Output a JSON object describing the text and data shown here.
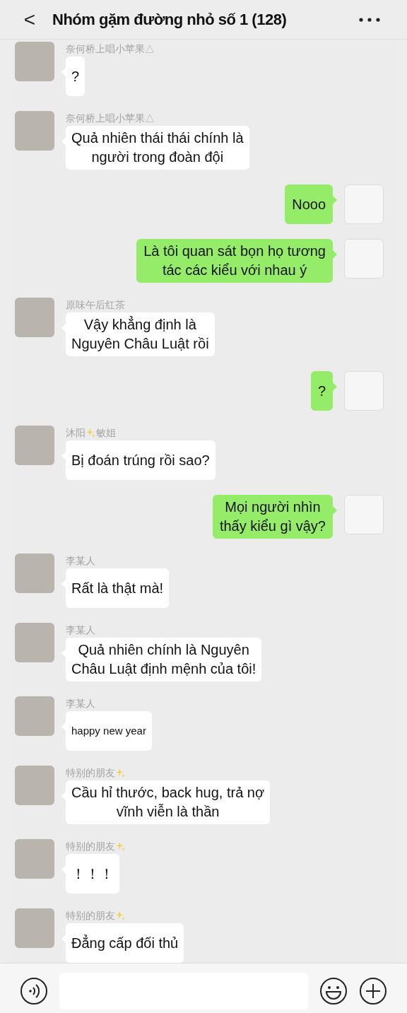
{
  "header": {
    "back": "<",
    "title": "Nhóm gặm đường nhỏ số 1 (128)"
  },
  "messages": [
    {
      "kind": "incoming",
      "name": [
        "奈何桥上唱小苹果△"
      ],
      "sparkle_end": false,
      "text": "?"
    },
    {
      "kind": "incoming",
      "name": [
        "奈何桥上唱小苹果△"
      ],
      "sparkle_end": false,
      "text": "Quả nhiên thái thái chính là\nngười trong đoàn đội"
    },
    {
      "kind": "outgoing",
      "text": "Nooo"
    },
    {
      "kind": "outgoing",
      "text": "Là tôi quan sát bọn họ tương\ntác các kiểu với nhau ý"
    },
    {
      "kind": "incoming",
      "name": [
        "原味午后红茶"
      ],
      "sparkle_end": false,
      "text": "Vậy khẳng định là\nNguyên Châu Luật rồi"
    },
    {
      "kind": "outgoing",
      "text": "?"
    },
    {
      "kind": "incoming",
      "name": [
        "沐阳",
        "敏姐"
      ],
      "sparkle_end": false,
      "text": "Bị đoán trúng rồi sao?"
    },
    {
      "kind": "outgoing",
      "text": "Mọi người nhìn\nthấy kiểu gì vậy?"
    },
    {
      "kind": "incoming",
      "name": [
        "李某人"
      ],
      "sparkle_end": false,
      "text": "Rất là thật mà!"
    },
    {
      "kind": "incoming",
      "name": [
        "李某人"
      ],
      "sparkle_end": false,
      "text": "Quả nhiên chính là Nguyên\nChâu Luật định mệnh của tôi!"
    },
    {
      "kind": "incoming",
      "name": [
        "李某人"
      ],
      "sparkle_end": false,
      "text": "happy new year",
      "small": true
    },
    {
      "kind": "incoming",
      "name": [
        "特别的朋友"
      ],
      "sparkle_end": true,
      "text": "Cầu hỉ thước, back hug, trả nợ\nvĩnh viễn là thần"
    },
    {
      "kind": "incoming",
      "name": [
        "特别的朋友"
      ],
      "sparkle_end": true,
      "text": "！！！"
    },
    {
      "kind": "incoming",
      "name": [
        "特别的朋友"
      ],
      "sparkle_end": true,
      "text": "Đẳng cấp đối thủ"
    }
  ]
}
